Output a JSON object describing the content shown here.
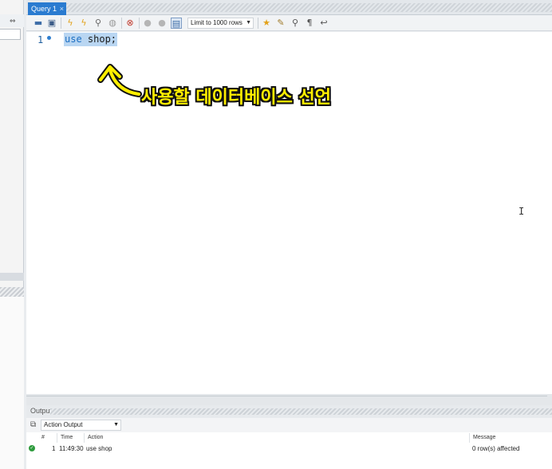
{
  "tab": {
    "label": "Query 1",
    "close": "×"
  },
  "toolbar": {
    "limit_select": "Limit to 1000 rows",
    "icons": [
      "open-folder-icon",
      "save-icon",
      "execute-icon",
      "execute-current-icon",
      "explain-icon",
      "stop-icon",
      "toggle-error-icon",
      "commit-icon",
      "rollback-icon",
      "autocommit-icon",
      "limit-dropdown",
      "bookmark-icon",
      "beautify-icon",
      "find-icon",
      "invisible-chars-icon",
      "wrap-icon"
    ]
  },
  "editor": {
    "line_number": "1",
    "keyword": "use",
    "rest": " shop;",
    "cursor_glyph": "I"
  },
  "annotation": {
    "text": "사용할 데이터베이스 선언",
    "color": "#ffee00"
  },
  "output": {
    "title": "Output",
    "selector": "Action Output",
    "columns": {
      "num": "#",
      "time": "Time",
      "action": "Action",
      "message": "Message"
    },
    "rows": [
      {
        "num": "1",
        "time": "11:49:30",
        "action": "use shop",
        "message": "0 row(s) affected",
        "status": "success"
      }
    ]
  },
  "colors": {
    "accent": "#2a7bd0",
    "selection": "#b9d6f2",
    "success": "#2e9b3d"
  }
}
